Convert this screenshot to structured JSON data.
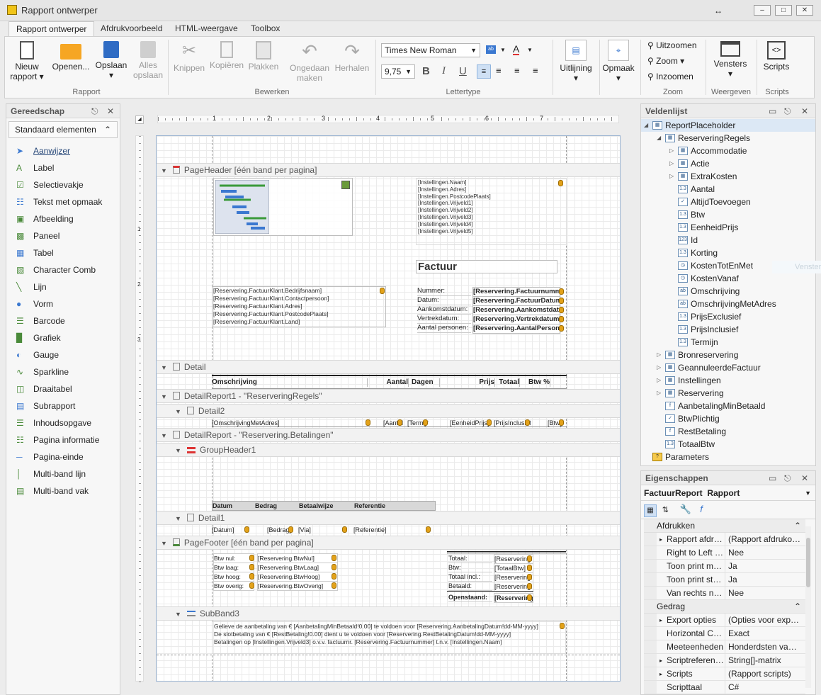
{
  "window": {
    "title": "Rapport ontwerper"
  },
  "tabs": [
    "Rapport ontwerper",
    "Afdrukvoorbeeld",
    "HTML-weergave",
    "Toolbox"
  ],
  "ribbon": {
    "nieuw": "Nieuw",
    "rapport": "rapport",
    "openen": "Openen...",
    "opslaan": "Opslaan",
    "alles1": "Alles",
    "alles2": "opslaan",
    "knippen": "Knippen",
    "kopieren": "Kopiëren",
    "plakken": "Plakken",
    "ongedaan1": "Ongedaan",
    "ongedaan2": "maken",
    "herhalen": "Herhalen",
    "font": "Times New Roman",
    "size": "9,75",
    "bold": "B",
    "italic": "I",
    "underline": "U",
    "uitlijning": "Uitlijning",
    "opmaak": "Opmaak",
    "uitzoomen": "Uitzoomen",
    "zoom": "Zoom",
    "inzoomen": "Inzoomen",
    "vensters": "Vensters",
    "scripts": "Scripts",
    "groups": [
      "Rapport",
      "Bewerken",
      "Lettertype",
      "Zoom",
      "Weergeven",
      "Scripts"
    ]
  },
  "toolbox": {
    "title": "Gereedschap",
    "category": "Standaard elementen",
    "items": [
      "Aanwijzer",
      "Label",
      "Selectievakje",
      "Tekst met opmaak",
      "Afbeelding",
      "Paneel",
      "Tabel",
      "Character Comb",
      "Lijn",
      "Vorm",
      "Barcode",
      "Grafiek",
      "Gauge",
      "Sparkline",
      "Draaitabel",
      "Subrapport",
      "Inhoudsopgave",
      "Pagina informatie",
      "Pagina-einde",
      "Multi-band lijn",
      "Multi-band vak"
    ]
  },
  "ruler": [
    "1",
    "2",
    "3",
    "4",
    "5",
    "6",
    "7"
  ],
  "vruler": [
    "1",
    "2",
    "3"
  ],
  "designer": {
    "bands": [
      "PageHeader [één band per pagina]",
      "Detail",
      "DetailReport1 - \"ReserveringRegels\"",
      "Detail2",
      "DetailReport - \"Reservering.Betalingen\"",
      "GroupHeader1",
      "Detail1",
      "PageFooter [één band per pagina]",
      "SubBand3"
    ],
    "instellingen": [
      "[Instellingen.Naam]",
      "[Instellingen.Adres]",
      "[Instellingen.PostcodePlaats]",
      "[Instellingen.Vrijveld1]",
      "[Instellingen.Vrijveld2]",
      "[Instellingen.Vrijveld3]",
      "[Instellingen.Vrijveld4]",
      "[Instellingen.Vrijveld5]"
    ],
    "factuur": "Factuur",
    "klant": [
      "[Reservering.FactuurKlant.Bedrijfsnaam]",
      "[Reservering.FactuurKlant.Contactpersoon]",
      "[Reservering.FactuurKlant.Adres]",
      "[Reservering.FactuurKlant.PostcodePlaats]",
      "[Reservering.FactuurKlant.Land]"
    ],
    "info_labels": [
      "Nummer:",
      "Datum:",
      "Aankomstdatum:",
      "Vertrekdatum:",
      "Aantal personen:"
    ],
    "info_values": [
      "[Reservering.Factuurnummer]",
      "[Reservering.FactuurDatum]",
      "[Reservering.Aankomstdatum]",
      "[Reservering.Vertrekdatum]",
      "[Reservering.AantalPersonen]"
    ],
    "detail_headers": [
      "Omschrijving",
      "Aantal",
      "Dagen",
      "Prijs",
      "Totaal",
      "Btw %"
    ],
    "detail2": [
      "[OmschrijvingMetAdres]",
      "[Aantal]",
      "[Termijn]",
      "[EenheidPrijs]",
      "[PrijsInclusief]",
      "[Btw]"
    ],
    "group_headers": [
      "Datum",
      "Bedrag",
      "Betaalwijze",
      "Referentie"
    ],
    "detail1": [
      "[Datum]",
      "[Bedrag]",
      "[Via]",
      "[Referentie]"
    ],
    "btw_labels": [
      "Btw nul:",
      "Btw laag:",
      "Btw hoog:",
      "Btw overig:"
    ],
    "btw_values": [
      "[Reservering.BtwNul]",
      "[Reservering.BtwLaag]",
      "[Reservering.BtwHoog]",
      "[Reservering.BtwOverig]"
    ],
    "tot_labels": [
      "Totaal:",
      "Btw:",
      "Totaal incl.:",
      "Betaald:",
      "Openstaand:"
    ],
    "tot_values": [
      "[Reservering.Totaal]",
      "[TotaalBtw]",
      "[Reservering.TotaalInclusief]",
      "[Reservering.Betaald]",
      "[Reservering.Openstaand]"
    ],
    "subband": [
      "Gelieve de aanbetaling van € [AanbetalingMinBetaald!0.00] te voldoen voor [Reservering.AanbetalingDatum!dd-MM-yyyy]",
      "De slotbetaling van € [RestBetaling!0.00] dient u te voldoen voor [Reservering.RestBetalingDatum!dd-MM-yyyy]",
      "Betalingen op [Instellingen.Vrijveld3] o.v.v. factuurnr. [Reservering.Factuurnummer] t.n.v. [Instellingen.Naam]"
    ]
  },
  "fields": {
    "title": "Veldenlijst",
    "root": "ReportPlaceholder",
    "group": "ReserveringRegels",
    "children": [
      [
        "Accommodatie",
        "tbl"
      ],
      [
        "Actie",
        "tbl"
      ],
      [
        "ExtraKosten",
        "tbl"
      ],
      [
        "Aantal",
        "1.3"
      ],
      [
        "AltijdToevoegen",
        "chk"
      ],
      [
        "Btw",
        "1.3"
      ],
      [
        "EenheidPrijs",
        "1.3"
      ],
      [
        "Id",
        "123"
      ],
      [
        "Korting",
        "1.3"
      ],
      [
        "KostenTotEnMet",
        "clk"
      ],
      [
        "KostenVanaf",
        "clk"
      ],
      [
        "Omschrijving",
        "ab"
      ],
      [
        "OmschrijvingMetAdres",
        "ab"
      ],
      [
        "PrijsExclusief",
        "1.3"
      ],
      [
        "PrijsInclusief",
        "1.3"
      ],
      [
        "Termijn",
        "1.3"
      ]
    ],
    "others": [
      [
        "Bronreservering",
        "tbl"
      ],
      [
        "GeannuleerdeFactuur",
        "tbl"
      ],
      [
        "Instellingen",
        "tbl"
      ],
      [
        "Reservering",
        "tbl"
      ],
      [
        "AanbetalingMinBetaald",
        "fx"
      ],
      [
        "BtwPlichtig",
        "chk"
      ],
      [
        "RestBetaling",
        "fx"
      ],
      [
        "TotaalBtw",
        "1.3"
      ]
    ],
    "parameters": "Parameters",
    "ghost": "Vensters"
  },
  "properties": {
    "title": "Eigenschappen",
    "object": "FactuurReport",
    "type": "Rapport",
    "cat1": "Afdrukken",
    "rows1": [
      [
        "Rapport afdrukken",
        "(Rapport afdrukopties)"
      ],
      [
        "Right to Left Layout",
        "Nee"
      ],
      [
        "Toon print marges",
        "Ja"
      ],
      [
        "Toon print status",
        "Ja"
      ],
      [
        "Van rechts naar links",
        "Nee"
      ]
    ],
    "cat2": "Gedrag",
    "rows2": [
      [
        "Export opties",
        "(Opties voor export)"
      ],
      [
        "Horizontal Content",
        "Exact"
      ],
      [
        "Meeteenheden",
        "Honderdsten van een inch"
      ],
      [
        "Scriptreferenties",
        "String[]-matrix"
      ],
      [
        "Scripts",
        "(Rapport scripts)"
      ],
      [
        "Scripttaal",
        "C#"
      ]
    ]
  }
}
